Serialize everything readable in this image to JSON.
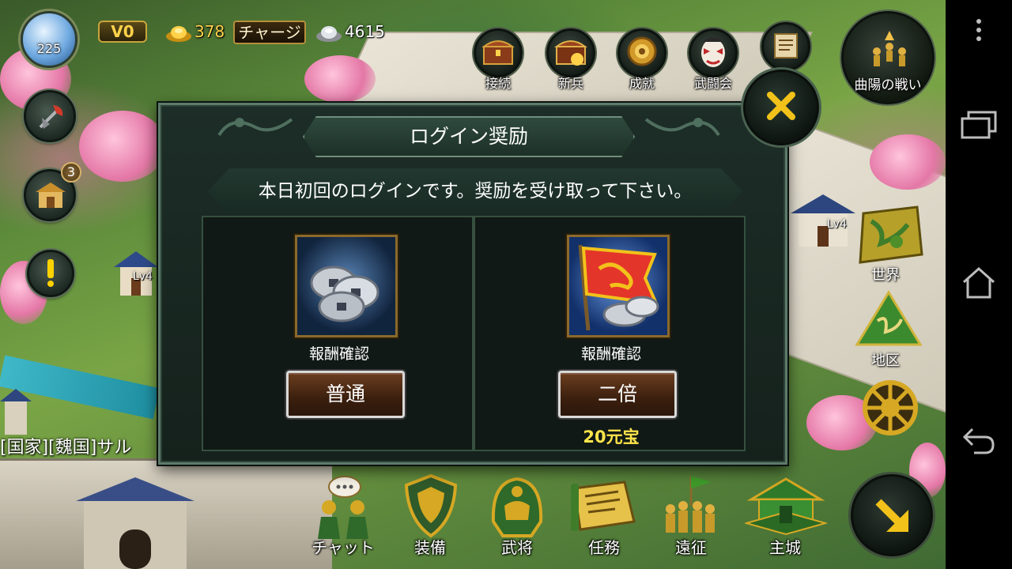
{
  "colors": {
    "gold_text": "#ffd24a",
    "cost_text": "#ffe54a",
    "dialog_bg": "#15211c",
    "dialog_border": "#5d7a6a"
  },
  "status": {
    "avatar_level": "225",
    "vip": "V0",
    "gold": "378",
    "charge_label": "チャージ",
    "silver": "4615"
  },
  "top_menu": [
    {
      "label": "接続",
      "icon": "treasure-chest-icon"
    },
    {
      "label": "新兵",
      "icon": "recruit-chest-icon"
    },
    {
      "label": "成就",
      "icon": "medal-icon"
    },
    {
      "label": "武闘会",
      "icon": "mask-icon"
    },
    {
      "label": "",
      "icon": "scroll-icon"
    }
  ],
  "battle": {
    "label": "曲陽の戦い",
    "icon": "army-icon"
  },
  "left_menu": {
    "badge_count": "3",
    "icons": [
      "battle-axe-icon",
      "building-icon",
      "alert-icon"
    ]
  },
  "right_menu": [
    {
      "label": "世界",
      "icon": "world-map-icon"
    },
    {
      "label": "地区",
      "icon": "mountain-icon"
    },
    {
      "label": "",
      "icon": "gear-wheel-icon"
    }
  ],
  "world": {
    "lv_left": "Lv4",
    "lv_right": "Lv4"
  },
  "chat": {
    "ticker": "[国家][魏国]サル"
  },
  "bottom_menu": [
    {
      "label": "チャット",
      "icon": "chat-icon"
    },
    {
      "label": "装備",
      "icon": "shield-icon"
    },
    {
      "label": "武将",
      "icon": "helmet-icon"
    },
    {
      "label": "任務",
      "icon": "quest-scroll-icon"
    },
    {
      "label": "遠征",
      "icon": "expedition-icon"
    },
    {
      "label": "主城",
      "icon": "castle-icon"
    }
  ],
  "dialog": {
    "title": "ログイン奨励",
    "message": "本日初回のログインです。奨励を受け取って下さい。",
    "rewards": [
      {
        "caption": "報酬確認",
        "button": "普通",
        "cost": "",
        "icon": "silver-coins-icon"
      },
      {
        "caption": "報酬確認",
        "button": "二倍",
        "cost": "20元宝",
        "icon": "dragon-banner-icon"
      }
    ],
    "close_icon": "close-x-icon"
  }
}
